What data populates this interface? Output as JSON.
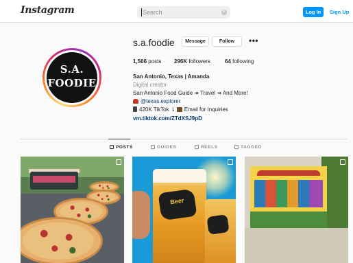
{
  "header": {
    "logo_text": "Instagram",
    "search_placeholder": "Search",
    "login_label": "Log In",
    "signup_label": "Sign Up"
  },
  "profile": {
    "username": "s.a.foodie",
    "avatar_line1": "S.A.",
    "avatar_line2": "FOODIE",
    "message_label": "Message",
    "follow_label": "Follow",
    "more_label": "•••",
    "stats": {
      "posts_count": "1,566",
      "posts_label": "posts",
      "followers_count": "296K",
      "followers_label": "followers",
      "following_count": "64",
      "following_label": "following"
    },
    "bio": {
      "name": "San Antonio, Texas | Amanda",
      "category": "Digital creator",
      "line1": "San Antonio Food Guide ↠ Travel ↠ And More!",
      "mention": "@texas.explorer",
      "line3_part1": "420K TikTok",
      "line3_arrow": "⇂",
      "line3_part2": "Email for Inquiries",
      "link": "vm.tiktok.com/ZTdXSJ9pD"
    }
  },
  "tabs": [
    {
      "label": "POSTS",
      "active": true
    },
    {
      "label": "GUIDES",
      "active": false
    },
    {
      "label": "REELS",
      "active": false
    },
    {
      "label": "TAGGED",
      "active": false
    }
  ],
  "posts": {
    "beer_badge_text": "Beer"
  },
  "colors": {
    "accent": "#0095f6",
    "text": "#262626",
    "muted": "#8e8e8e",
    "border": "#dbdbdb"
  }
}
